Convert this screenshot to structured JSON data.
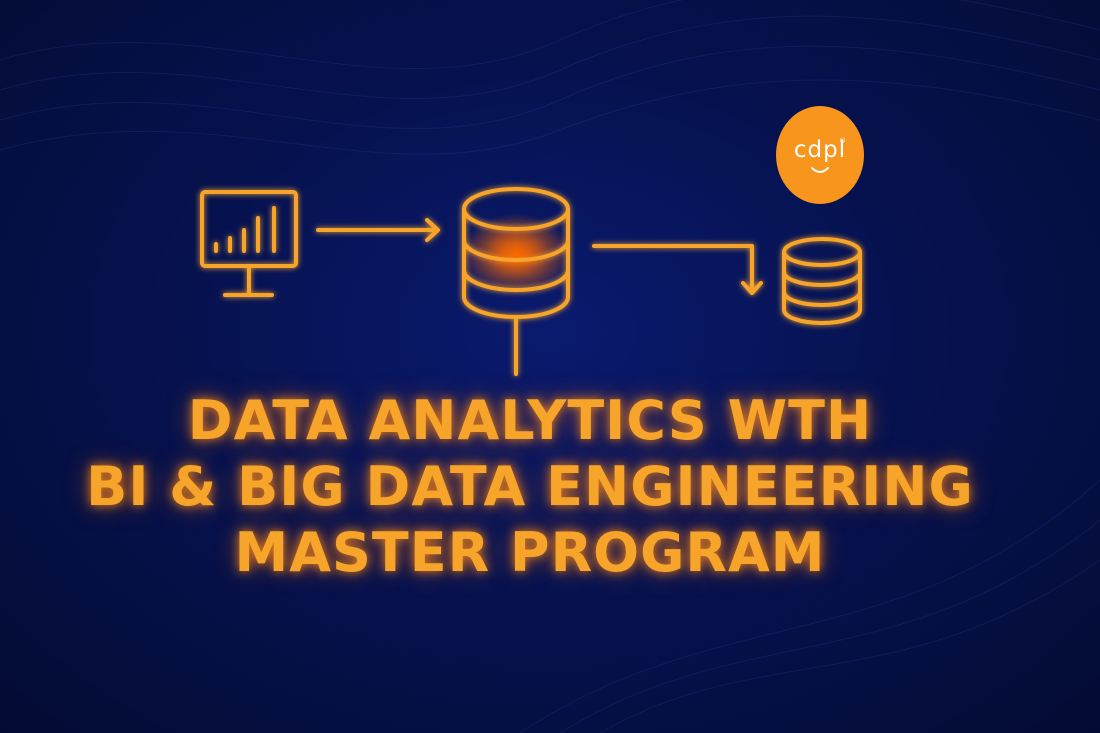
{
  "headline": {
    "line1": "DATA ANALYTICS WTH",
    "line2": "BI & BIG DATA ENGINEERING",
    "line3": "MASTER PROGRAM"
  },
  "logo": {
    "text": "cdpl",
    "mark": "®"
  },
  "icons": [
    "monitor-bar-chart-icon",
    "database-icon",
    "database-icon",
    "arrow-right-icon",
    "arrow-elbow-down-icon"
  ],
  "colors": {
    "accent": "#f7a52a",
    "glow": "#ff8a1a",
    "logo_bg": "#f7951d",
    "background": "#061250"
  }
}
